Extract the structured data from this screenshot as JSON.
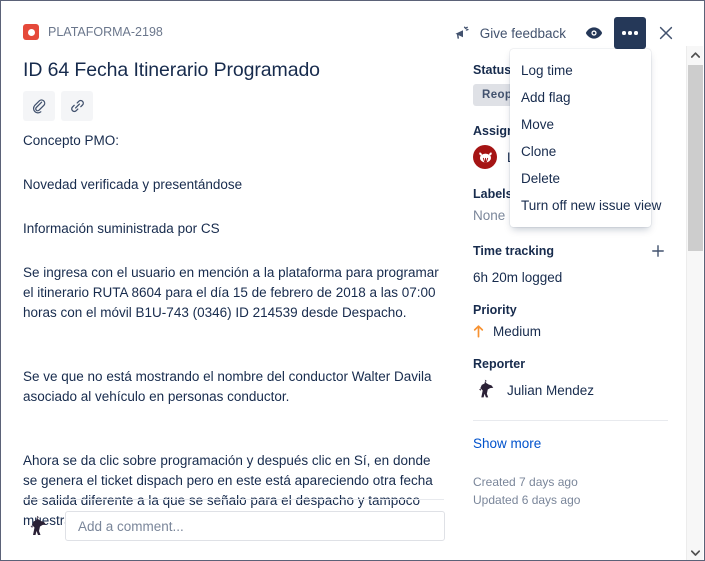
{
  "window": {
    "border_color": "#5b6278",
    "background": "#ffffff"
  },
  "header": {
    "breadcrumb": "PLATAFORMA-2198",
    "breadcrumb_icon": "bug-icon",
    "breadcrumb_icon_color": "#e5493a",
    "feedback_label": "Give feedback",
    "feedback_icon": "megaphone-icon",
    "watch_icon": "eye-icon",
    "more_icon": "ellipsis-icon",
    "more_button_color": "#253858",
    "close_icon": "close-icon"
  },
  "issue": {
    "title": "ID 64 Fecha Itinerario Programado",
    "attach_icon": "paperclip-icon",
    "link_icon": "link-icon",
    "description_paragraphs": [
      "Concepto PMO:",
      "Novedad verificada y presentándose",
      "Información suministrada por CS",
      "Se ingresa con el usuario en mención a la plataforma para programar el itinerario RUTA 8604 para el día 15 de febrero de 2018 a las 07:00 horas con el móvil B1U-743 (0346) ID 214539 desde Despacho.",
      "Se ve que no está mostrando el nombre del conductor Walter Davila asociado al vehículo en personas conductor.",
      "Ahora se da clic sobre programación y después clic en Sí, en donde se genera el ticket dispach pero en este está apareciendo otra fecha de salida diferente a la que se señalo para el despacho y tampoco muestra el conductor."
    ]
  },
  "comment": {
    "placeholder": "Add a comment...",
    "avatar_icon": "user-avatar"
  },
  "sidebar": {
    "status": {
      "label": "Status",
      "value": "Reop",
      "badge_bg": "#dfe1e6"
    },
    "assignee": {
      "label": "Assignee",
      "value": "Lu",
      "avatar_icon": "bull-avatar",
      "avatar_color": "#a51414"
    },
    "labels": {
      "label": "Labels",
      "value": "None"
    },
    "time_tracking": {
      "label": "Time tracking",
      "add_icon": "plus-icon",
      "logged": "6h 20m logged"
    },
    "priority": {
      "label": "Priority",
      "value": "Medium",
      "arrow_icon": "arrow-up-icon",
      "arrow_color": "#f79232"
    },
    "reporter": {
      "label": "Reporter",
      "value": "Julian Mendez",
      "avatar_icon": "user-avatar"
    },
    "show_more": "Show more",
    "created": "Created 7 days ago",
    "updated": "Updated 6 days ago"
  },
  "dropdown": {
    "items": [
      {
        "label": "Log time"
      },
      {
        "label": "Add flag"
      },
      {
        "label": "Move"
      },
      {
        "label": "Clone"
      },
      {
        "label": "Delete"
      },
      {
        "label": "Turn off new issue view"
      }
    ]
  },
  "scrollbar": {
    "up_icon": "chevron-up-icon",
    "down_icon": "chevron-down-icon"
  }
}
